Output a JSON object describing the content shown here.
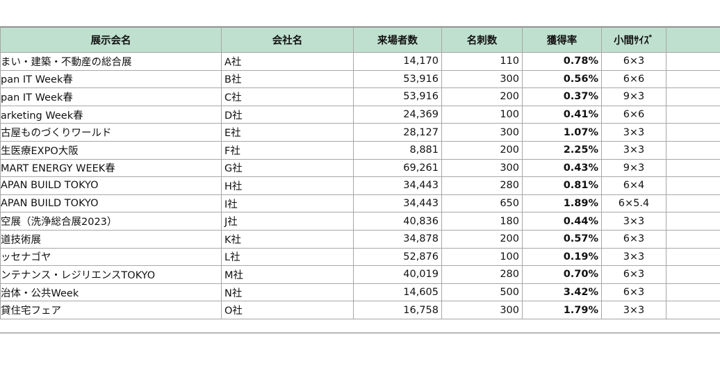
{
  "table": {
    "headers": [
      "展示会名",
      "会社名",
      "来場者数",
      "名刺数",
      "獲得率",
      "小間ｻｲｽﾞ",
      ""
    ],
    "rows": [
      {
        "name": "まい・建築・不動産の総合展",
        "company": "A社",
        "visitors": "14,170",
        "cards": "110",
        "rate": "0.78%",
        "size": "6×3"
      },
      {
        "name": "pan IT Week春",
        "company": "B社",
        "visitors": "53,916",
        "cards": "300",
        "rate": "0.56%",
        "size": "6×6"
      },
      {
        "name": "pan IT Week春",
        "company": "C社",
        "visitors": "53,916",
        "cards": "200",
        "rate": "0.37%",
        "size": "9×3"
      },
      {
        "name": "arketing Week春",
        "company": "D社",
        "visitors": "24,369",
        "cards": "100",
        "rate": "0.41%",
        "size": "6×6"
      },
      {
        "name": "古屋ものづくりワールド",
        "company": "E社",
        "visitors": "28,127",
        "cards": "300",
        "rate": "1.07%",
        "size": "3×3"
      },
      {
        "name": "生医療EXPO大阪",
        "company": "F社",
        "visitors": "8,881",
        "cards": "200",
        "rate": "2.25%",
        "size": "3×3"
      },
      {
        "name": "MART ENERGY WEEK春",
        "company": "G社",
        "visitors": "69,261",
        "cards": "300",
        "rate": "0.43%",
        "size": "9×3"
      },
      {
        "name": "APAN BUILD TOKYO",
        "company": "H社",
        "visitors": "34,443",
        "cards": "280",
        "rate": "0.81%",
        "size": "6×4"
      },
      {
        "name": "APAN BUILD TOKYO",
        "company": "I社",
        "visitors": "34,443",
        "cards": "650",
        "rate": "1.89%",
        "size": "6×5.4"
      },
      {
        "name": "空展（洗浄総合展2023）",
        "company": "J社",
        "visitors": "40,836",
        "cards": "180",
        "rate": "0.44%",
        "size": "3×3"
      },
      {
        "name": "道技術展",
        "company": "K社",
        "visitors": "34,878",
        "cards": "200",
        "rate": "0.57%",
        "size": "6×3"
      },
      {
        "name": "ッセナゴヤ",
        "company": "L社",
        "visitors": "52,876",
        "cards": "100",
        "rate": "0.19%",
        "size": "3×3"
      },
      {
        "name": "ンテナンス・レジリエンスTOKYO",
        "company": "M社",
        "visitors": "40,019",
        "cards": "280",
        "rate": "0.70%",
        "size": "6×3"
      },
      {
        "name": "治体・公共Week",
        "company": "N社",
        "visitors": "14,605",
        "cards": "500",
        "rate": "3.42%",
        "size": "6×3"
      },
      {
        "name": "貸住宅フェア",
        "company": "O社",
        "visitors": "16,758",
        "cards": "300",
        "rate": "1.79%",
        "size": "3×3"
      }
    ]
  }
}
